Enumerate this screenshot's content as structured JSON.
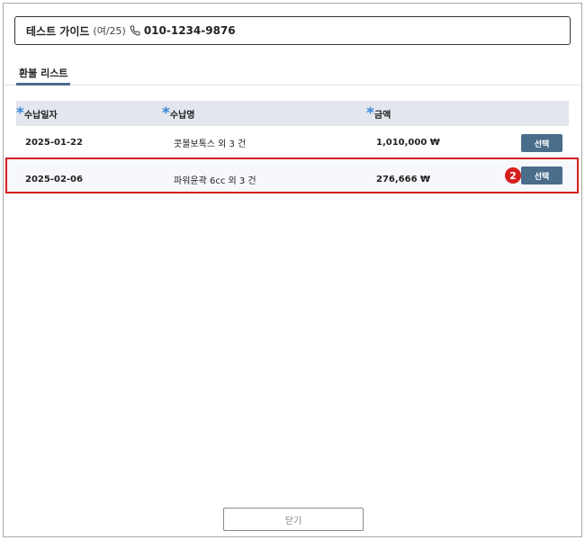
{
  "patient": {
    "name": "테스트 가이드",
    "meta": "(여/25)",
    "phone": "010-1234-9876"
  },
  "tabs": [
    {
      "label": "환불 리스트",
      "active": true
    }
  ],
  "table": {
    "required_mark": "*",
    "columns": [
      "수납일자",
      "수납명",
      "금액"
    ],
    "rows": [
      {
        "date": "2025-01-22",
        "name": "콧볼보톡스 외 3 건",
        "amount": "1,010,000 ₩",
        "action": "선택"
      },
      {
        "date": "2025-02-06",
        "name": "파워윤곽 6cc 외 3 건",
        "amount": "276,666 ₩",
        "action": "선택"
      }
    ]
  },
  "highlight": {
    "step": "2",
    "color": "#d61f1f"
  },
  "footer": {
    "close_label": "닫기"
  },
  "colors": {
    "accent": "#4a6d8c",
    "header_bg": "#e3e6ed",
    "required_star": "#3a86d8"
  }
}
